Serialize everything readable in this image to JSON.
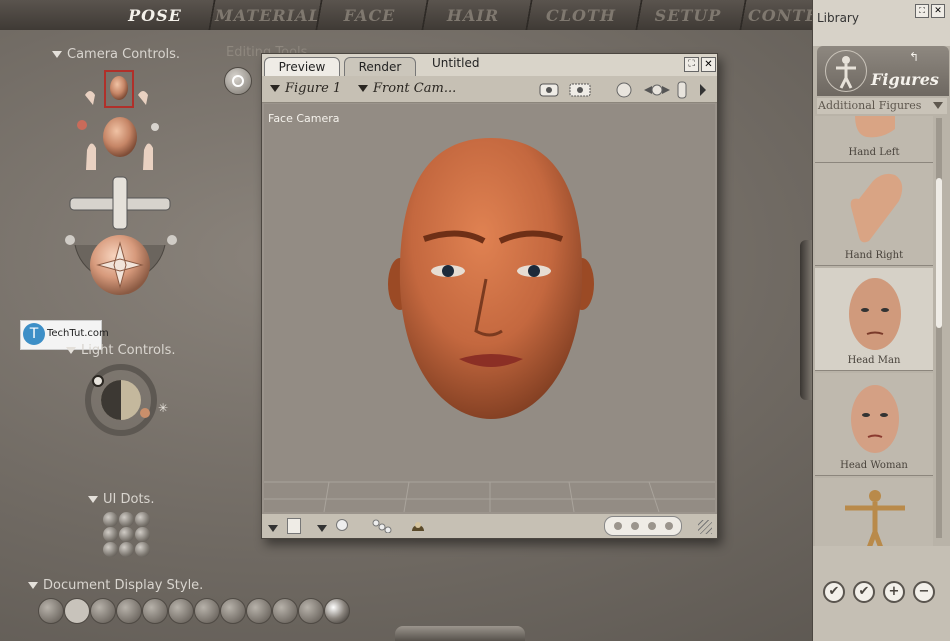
{
  "top_tabs": [
    {
      "label": "POSE",
      "active": true
    },
    {
      "label": "MATERIAL"
    },
    {
      "label": "FACE"
    },
    {
      "label": "HAIR"
    },
    {
      "label": "CLOTH"
    },
    {
      "label": "SETUP"
    },
    {
      "label": "CONTE"
    }
  ],
  "left_panel": {
    "camera_controls": "Camera Controls.",
    "editing_tools": "Editing Tools",
    "light_controls": "Light Controls.",
    "ui_dots": "UI Dots.",
    "document_display_style": "Document Display Style."
  },
  "watermark": {
    "text": "TechTut.com",
    "letter": "T"
  },
  "preview": {
    "tabs": [
      "Preview",
      "Render"
    ],
    "document_title": "Untitled",
    "figure_select": "Figure 1",
    "camera_select": "Front Cam...",
    "viewport_label": "Face Camera"
  },
  "library": {
    "title": "Library",
    "category": "Figures",
    "subcategory": "Additional Figures",
    "items": [
      {
        "label": "Hand Left"
      },
      {
        "label": "Hand Right"
      },
      {
        "label": "Head Man",
        "selected": true
      },
      {
        "label": "Head Woman"
      },
      {
        "label": ""
      }
    ],
    "footer_buttons": [
      "✔",
      "✔",
      "+",
      "−"
    ]
  },
  "colors": {
    "skin": "#c4683f",
    "skin_shadow": "#7a3a1f",
    "viewport_bg": "#938c84",
    "panel_bg": "#7a746d"
  }
}
